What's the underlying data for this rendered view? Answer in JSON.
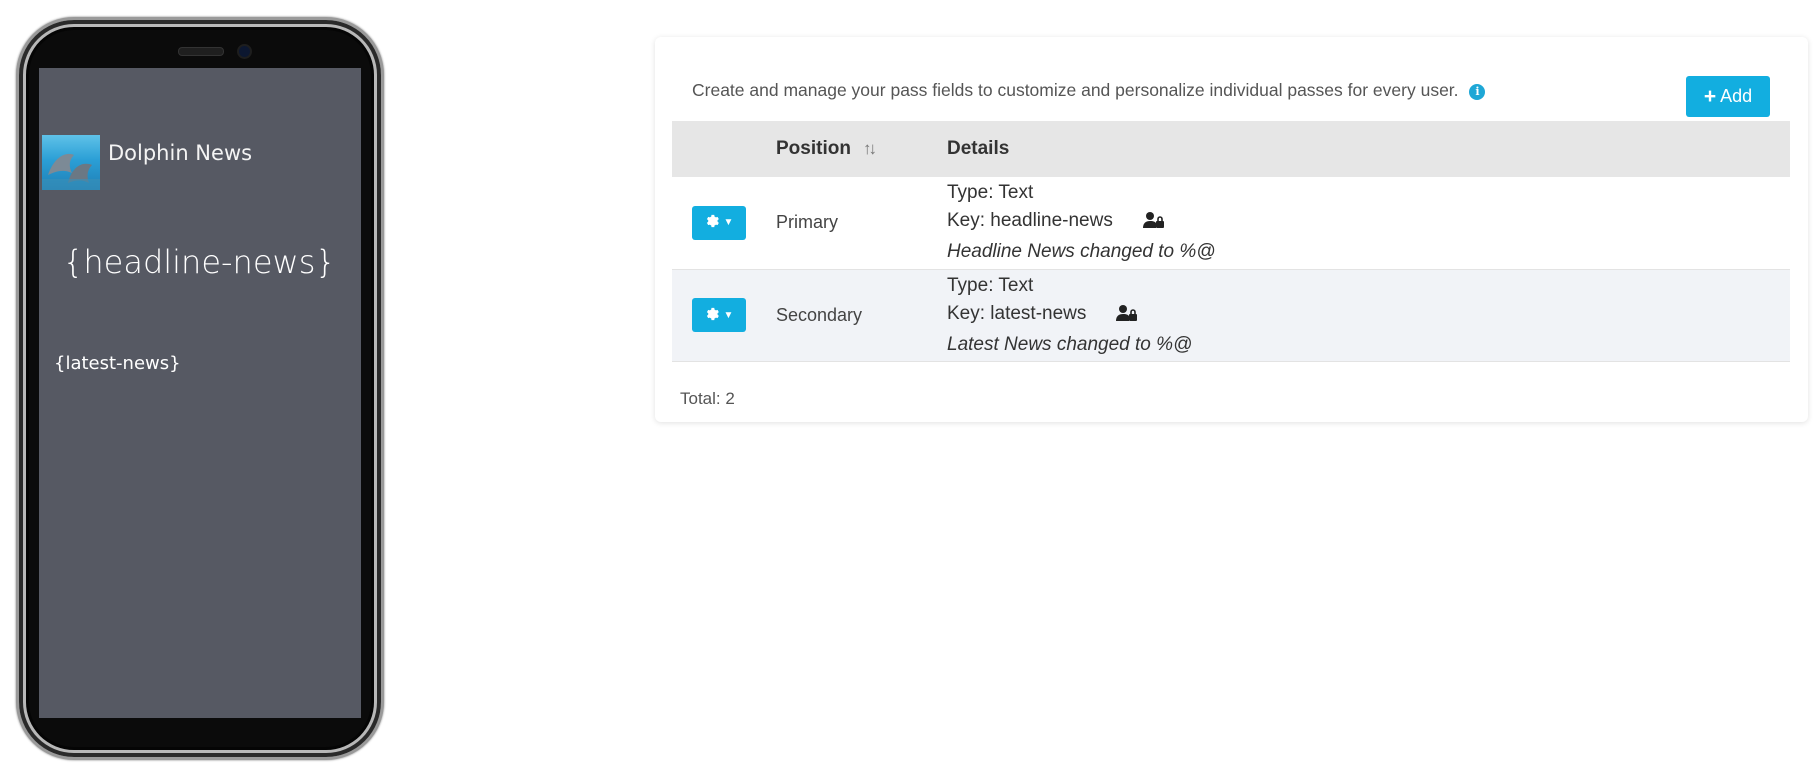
{
  "phone_preview": {
    "organization_name": "Dolphin News",
    "primary_field_value": "{headline-news}",
    "secondary_field_value": "{latest-news}"
  },
  "fields_panel": {
    "intro_text": "Create and manage your pass fields to customize and personalize individual passes for every user.",
    "add_button_label": "Add",
    "columns": {
      "action": "",
      "position": "Position",
      "details": "Details"
    },
    "rows": [
      {
        "position": "Primary",
        "type": "Type: Text",
        "key": "Key: headline-news",
        "change_message": "Headline News changed to %@"
      },
      {
        "position": "Secondary",
        "type": "Type: Text",
        "key": "Key: latest-news",
        "change_message": "Latest News changed to %@"
      }
    ],
    "total_text": "Total: 2"
  },
  "icons": {
    "info": "info-icon",
    "add": "plus-icon",
    "row_action": "gear-icon",
    "sort": "sort-arrows-icon",
    "personal_field": "user-lock-icon"
  },
  "colors": {
    "accent": "#12aee0",
    "phone_screen_background": "#565963",
    "table_header_background": "#e6e6e6"
  }
}
